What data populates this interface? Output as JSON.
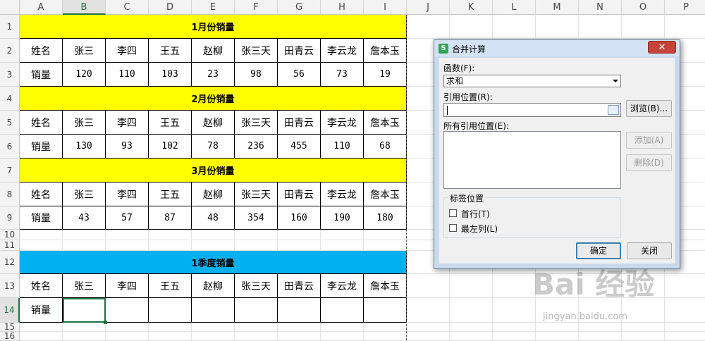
{
  "columns": [
    "A",
    "B",
    "C",
    "D",
    "E",
    "F",
    "G",
    "H",
    "I",
    "J",
    "K",
    "L",
    "M",
    "N",
    "O",
    "P"
  ],
  "rows": [
    "1",
    "2",
    "3",
    "4",
    "5",
    "6",
    "7",
    "8",
    "9",
    "10",
    "11",
    "12",
    "13",
    "14",
    "15",
    "16"
  ],
  "banners": {
    "jan": "1月份销量",
    "feb": "2月份销量",
    "mar": "3月份销量",
    "q1": "1季度销量"
  },
  "banner_colors": {
    "month": "#ffff00",
    "quarter": "#00b0f0"
  },
  "table_headers": [
    "姓名",
    "张三",
    "李四",
    "王五",
    "赵柳",
    "张三天",
    "田青云",
    "李云龙",
    "詹本玉"
  ],
  "sales_label": "销量",
  "jan_values": [
    "120",
    "110",
    "103",
    "23",
    "98",
    "56",
    "73",
    "19"
  ],
  "feb_values": [
    "130",
    "93",
    "102",
    "78",
    "236",
    "455",
    "110",
    "68"
  ],
  "mar_values": [
    "43",
    "57",
    "87",
    "48",
    "354",
    "160",
    "190",
    "180"
  ],
  "dialog": {
    "title": "合并计算",
    "function_label": "函数(F):",
    "function_value": "求和",
    "ref_label": "引用位置(R):",
    "ref_value": "",
    "browse_button": "浏览(B)...",
    "all_refs_label": "所有引用位置(E):",
    "add_button": "添加(A)",
    "delete_button": "删除(D)",
    "label_group": "标签位置",
    "first_row": "首行(T)",
    "left_column": "最左列(L)",
    "ok_button": "确定",
    "close_button": "关闭",
    "close_x": "✕"
  },
  "watermark": {
    "brand": "Bai 经验",
    "url": "jingyan.baidu.com"
  },
  "selection_color": "#217346"
}
